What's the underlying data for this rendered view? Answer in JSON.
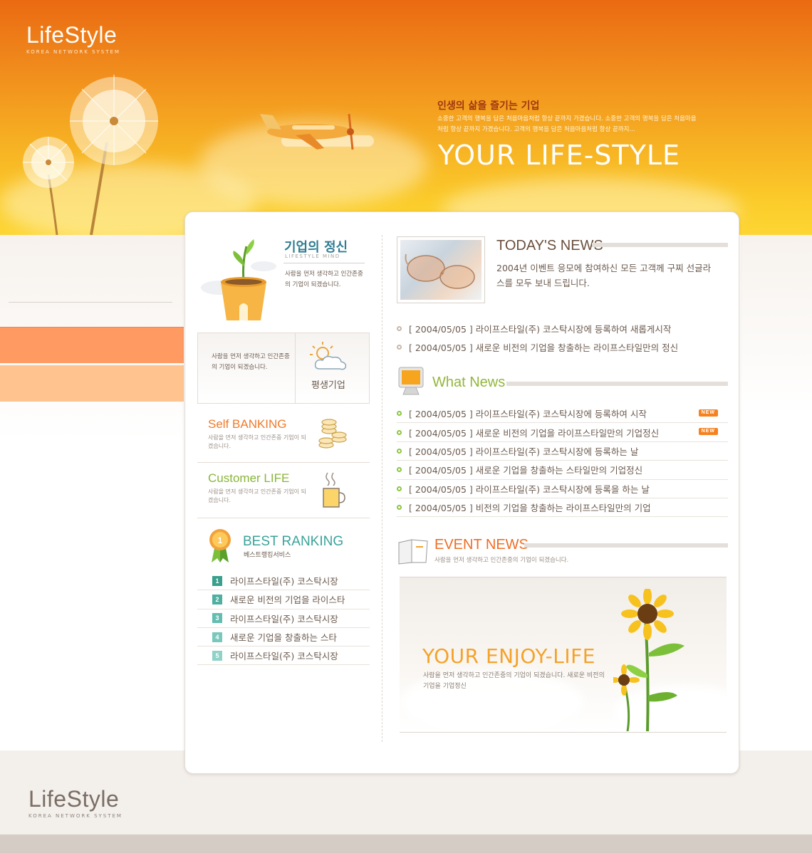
{
  "brand": {
    "name": "LifeStyle",
    "tagline": "KOREA NETWORK SYSTEM"
  },
  "hero": {
    "subhead": "인생의 삶을 즐기는 기업",
    "description": "소중한 고객의 행복을 담은 처음마음처럼 항상 끝까지 가겠습니다. 소중한 고객의 행복을 담은 처음마음처럼 항상 끝까지 가겠습니다. 고객의 행복을 담은 처음마음처럼 항상 끝까지...",
    "title": "YOUR LIFE-STYLE"
  },
  "spirit": {
    "title": "기업의 정신",
    "subtitle": "LIFESTYLE MIND",
    "text": "사람을 먼저 생각하고 인간존중의 기업이 되겠습니다."
  },
  "lifetime": {
    "text": "사람을 먼저 생각하고 인간존중의 기업이 되겠습니다.",
    "label": "평생기업"
  },
  "banking": {
    "title": "Self BANKING",
    "text": "사람을 먼저 생각하고 인간존중 기업이 되겠습니다."
  },
  "customer": {
    "title": "Customer LIFE",
    "text": "사람을 먼저 생각하고 인간존중 기업이 되겠습니다."
  },
  "ranking": {
    "title": "BEST RANKING",
    "subtitle": "베스트랭킹서비스",
    "items": [
      {
        "num": "1",
        "label": "라이프스타일(주) 코스탁시장",
        "color": "#3a9f8c"
      },
      {
        "num": "2",
        "label": "새로운 비전의 기업을 라이스타",
        "color": "#4fb0a0"
      },
      {
        "num": "3",
        "label": "라이프스타일(주) 코스탁시장",
        "color": "#63bdb0"
      },
      {
        "num": "4",
        "label": "새로운 기업을 창출하는 스타",
        "color": "#7ac8bd"
      },
      {
        "num": "5",
        "label": "라이프스타일(주) 코스탁시장",
        "color": "#8fd2c8"
      }
    ]
  },
  "today_news": {
    "title": "TODAY'S NEWS",
    "text": "2004년 이벤트 응모에 참여하신 모든 고객께 구찌 선글라스를 모두 보내 드립니다.",
    "items": [
      "[ 2004/05/05 ] 라이프스타일(주) 코스탁시장에 등록하여 새롭게시작",
      "[ 2004/05/05 ] 새로운 비전의 기업을 창출하는 라이프스타일만의 정신"
    ]
  },
  "what_news": {
    "title": "What News",
    "new_label": "NEW",
    "items": [
      {
        "text": "[ 2004/05/05 ] 라이프스타일(주) 코스탁시장에 등록하여 시작",
        "is_new": true
      },
      {
        "text": "[ 2004/05/05 ] 새로운 비전의 기업을 라이프스타일만의 기업정신",
        "is_new": true
      },
      {
        "text": "[ 2004/05/05 ] 라이프스타일(주) 코스탁시장에 등록하는 날",
        "is_new": false
      },
      {
        "text": "[ 2004/05/05 ] 새로운 기업을 창출하는 스타일만의 기업정신",
        "is_new": false
      },
      {
        "text": "[ 2004/05/05 ] 라이프스타일(주) 코스탁시장에 등록을 하는 날",
        "is_new": false
      },
      {
        "text": "[ 2004/05/05 ] 비전의 기업을 창출하는 라이프스타일만의 기업",
        "is_new": false
      }
    ]
  },
  "event_news": {
    "title": "EVENT NEWS",
    "subtitle": "사람을 먼저 생각하고 인간존중의 기업이 되겠습니다.",
    "banner_title": "YOUR ENJOY-LIFE",
    "banner_text": "사람을 먼저 생각하고 인간존중의 기업이 되겠습니다. 새로운 비전의 기업을 기업정신"
  },
  "footer": {
    "brand": "LifeStyle",
    "tagline": "KOREA NETWORK SYSTEM"
  },
  "colors": {
    "header_top": "#ea6a12",
    "header_bottom": "#fdd633",
    "accent_orange": "#f07a2a",
    "accent_green": "#8ab63a",
    "accent_teal": "#3aa39a"
  }
}
